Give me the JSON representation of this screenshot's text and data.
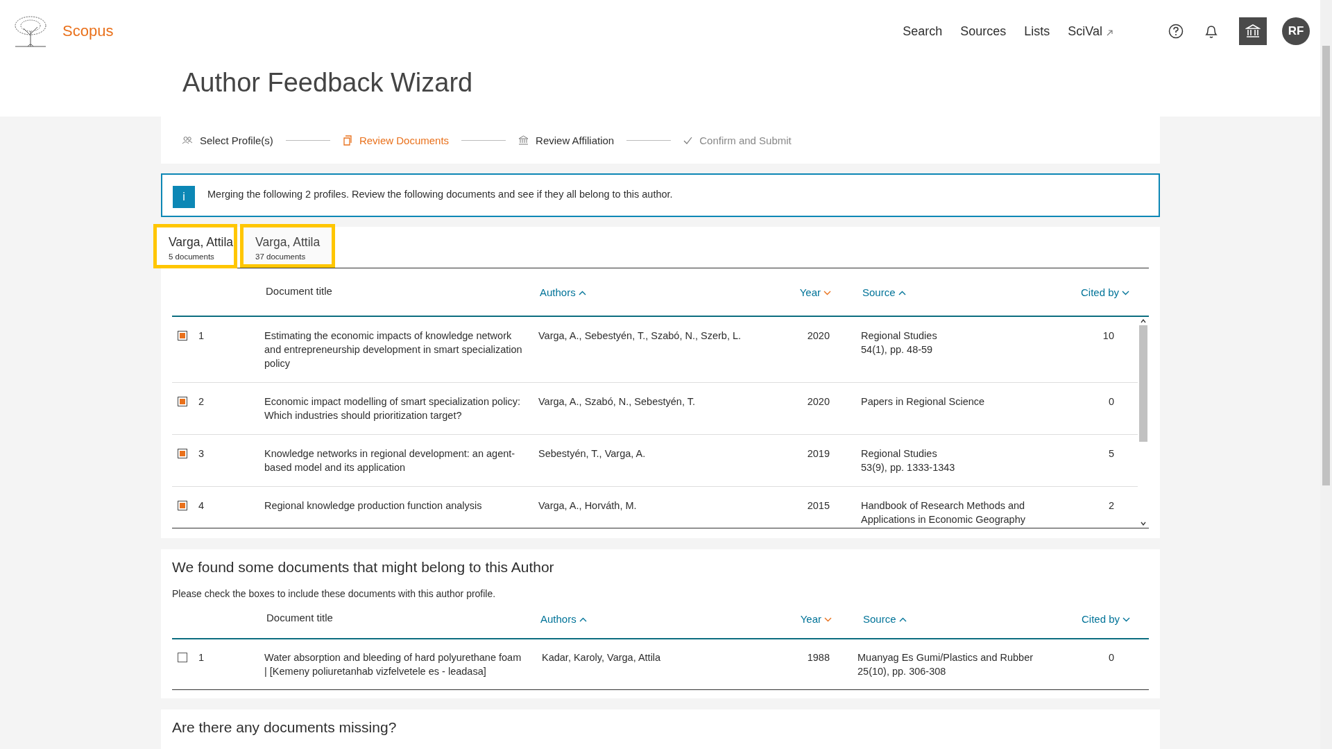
{
  "header": {
    "brand": "Scopus",
    "nav": [
      {
        "label": "Search",
        "external": false
      },
      {
        "label": "Sources",
        "external": false
      },
      {
        "label": "Lists",
        "external": false
      },
      {
        "label": "SciVal",
        "external": true
      }
    ],
    "avatar": "RF"
  },
  "page_title": "Author Feedback Wizard",
  "steps": [
    {
      "label": "Select Profile(s)",
      "kind": "people",
      "selected": false,
      "disabled": false
    },
    {
      "label": "Review Documents",
      "kind": "document",
      "selected": true,
      "disabled": false
    },
    {
      "label": "Review Affiliation",
      "kind": "institution",
      "selected": false,
      "disabled": false
    },
    {
      "label": "Confirm and Submit",
      "kind": "check",
      "selected": false,
      "disabled": true
    }
  ],
  "info": {
    "icon": "i",
    "message": "Merging the following 2 profiles. Review the following documents and see if they all belong to this author."
  },
  "profiles": [
    {
      "name": "Varga, Attila",
      "count": "5 documents",
      "selected": true,
      "highlighted": true
    },
    {
      "name": "Varga, Attila",
      "count": "37 documents",
      "selected": false,
      "highlighted": true
    }
  ],
  "documents": {
    "columns": [
      {
        "label": "Document title",
        "sortable": false
      },
      {
        "label": "Authors",
        "sortable": true,
        "ascending": true,
        "sorted": false
      },
      {
        "label": "Year",
        "sortable": true,
        "ascending": false,
        "sorted": true
      },
      {
        "label": "Source",
        "sortable": true,
        "ascending": true,
        "sorted": false
      },
      {
        "label": "Cited by",
        "sortable": true,
        "ascending": false,
        "sorted": false
      }
    ],
    "rows": [
      {
        "checked": true,
        "number": "1",
        "title": "Estimating the economic impacts of knowledge network and entrepreneurship development in smart specialization policy",
        "authors": "Varga, A., Sebestyén, T., Szabó, N., Szerb, L.",
        "year": "2020",
        "source": "Regional Studies",
        "source_detail": "54(1), pp. 48-59",
        "cited_by": "10"
      },
      {
        "checked": true,
        "number": "2",
        "title": "Economic impact modelling of smart specialization policy: Which industries should prioritization target?",
        "authors": "Varga, A., Szabó, N., Sebestyén, T.",
        "year": "2020",
        "source": "Papers in Regional Science",
        "cited_by": "0"
      },
      {
        "checked": true,
        "number": "3",
        "title": "Knowledge networks in regional development: an agent-based model and its application",
        "authors": "Sebestyén, T., Varga, A.",
        "year": "2019",
        "source": "Regional Studies",
        "source_detail": "53(9), pp. 1333-1343",
        "cited_by": "5"
      },
      {
        "checked": true,
        "number": "4",
        "title": "Regional knowledge production function analysis",
        "authors": "Varga, A., Horváth, M.",
        "year": "2015",
        "source": "Handbook of Research Methods and Applications in Economic Geography",
        "cited_by": "2"
      }
    ]
  },
  "suggested": {
    "heading": "We found some documents that might belong to this Author",
    "hint": "Please check the boxes to include these documents with this author profile.",
    "columns": [
      {
        "label": "Document title",
        "sortable": false
      },
      {
        "label": "Authors",
        "sortable": true,
        "ascending": true,
        "sorted": false
      },
      {
        "label": "Year",
        "sortable": true,
        "ascending": false,
        "sorted": true
      },
      {
        "label": "Source",
        "sortable": true,
        "ascending": true,
        "sorted": false
      },
      {
        "label": "Cited by",
        "sortable": true,
        "ascending": false,
        "sorted": false
      }
    ],
    "rows": [
      {
        "checked": false,
        "number": "1",
        "title": "Water absorption and bleeding of hard polyurethane foam | [Kemeny poliuretanhab vizfelvetele es - leadasa]",
        "authors": "Kadar, Karoly, Varga, Attila",
        "year": "1988",
        "source": "Muanyag Es Gumi/Plastics and Rubber",
        "source_detail": "25(10), pp. 306-308",
        "cited_by": "0"
      }
    ]
  },
  "missing": {
    "heading": "Are there any documents missing?"
  }
}
